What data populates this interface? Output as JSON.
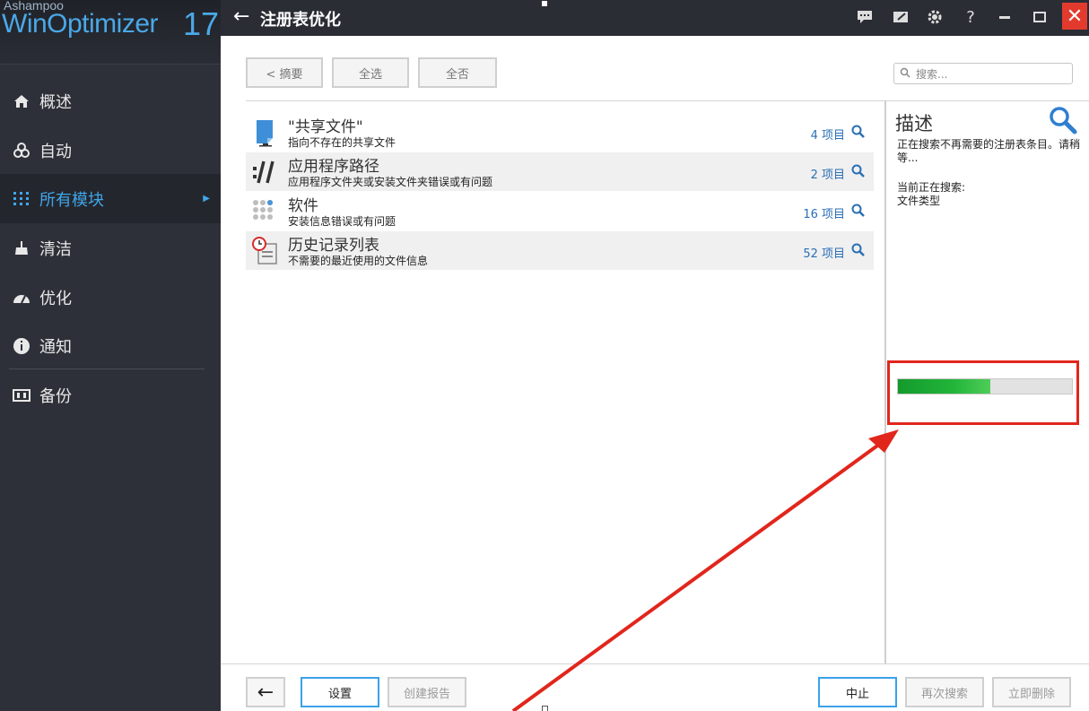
{
  "brand": {
    "small": "Ashampoo",
    "main": "WinOptimizer",
    "version": "17"
  },
  "sidebar": {
    "items": [
      {
        "label": "概述",
        "icon": "home-icon"
      },
      {
        "label": "自动",
        "icon": "biohazard-icon"
      },
      {
        "label": "所有模块",
        "icon": "grid-icon",
        "active": true
      },
      {
        "label": "清洁",
        "icon": "broom-icon"
      },
      {
        "label": "优化",
        "icon": "gauge-icon"
      },
      {
        "label": "通知",
        "icon": "info-icon"
      },
      {
        "label": "备份",
        "icon": "backup-icon"
      }
    ]
  },
  "titlebar": {
    "title": "注册表优化",
    "help": "?",
    "close": "✕"
  },
  "toolbar": {
    "summary": "< 摘要",
    "select_all": "全选",
    "select_none": "全否",
    "search_placeholder": "搜索..."
  },
  "rows": [
    {
      "title": "\"共享文件\"",
      "desc": "指向不存在的共享文件",
      "count": "4 项目",
      "icon": "shared-file-icon"
    },
    {
      "title": "应用程序路径",
      "desc": "应用程序文件夹或安装文件夹错误或有问题",
      "count": "2 项目",
      "icon": "app-path-icon"
    },
    {
      "title": "软件",
      "desc": "安装信息错误或有问题",
      "count": "16 项目",
      "icon": "software-icon"
    },
    {
      "title": "历史记录列表",
      "desc": "不需要的最近使用的文件信息",
      "count": "52 项目",
      "icon": "history-icon"
    }
  ],
  "description": {
    "title": "描述",
    "text": "正在搜索不再需要的注册表条目。请稍等...",
    "current_label": "当前正在搜索:",
    "current_value": "文件类型"
  },
  "progress": {
    "fraction": 0.53,
    "fill_color": "#1fa83a"
  },
  "bottom": {
    "back": "←",
    "settings": "设置",
    "create_report": "创建报告",
    "abort": "中止",
    "search_again": "再次搜索",
    "delete_now": "立即删除"
  },
  "colors": {
    "accent": "#3fa7ea",
    "sidebar_bg": "#2e3039",
    "highlight_red": "#e1261c"
  }
}
